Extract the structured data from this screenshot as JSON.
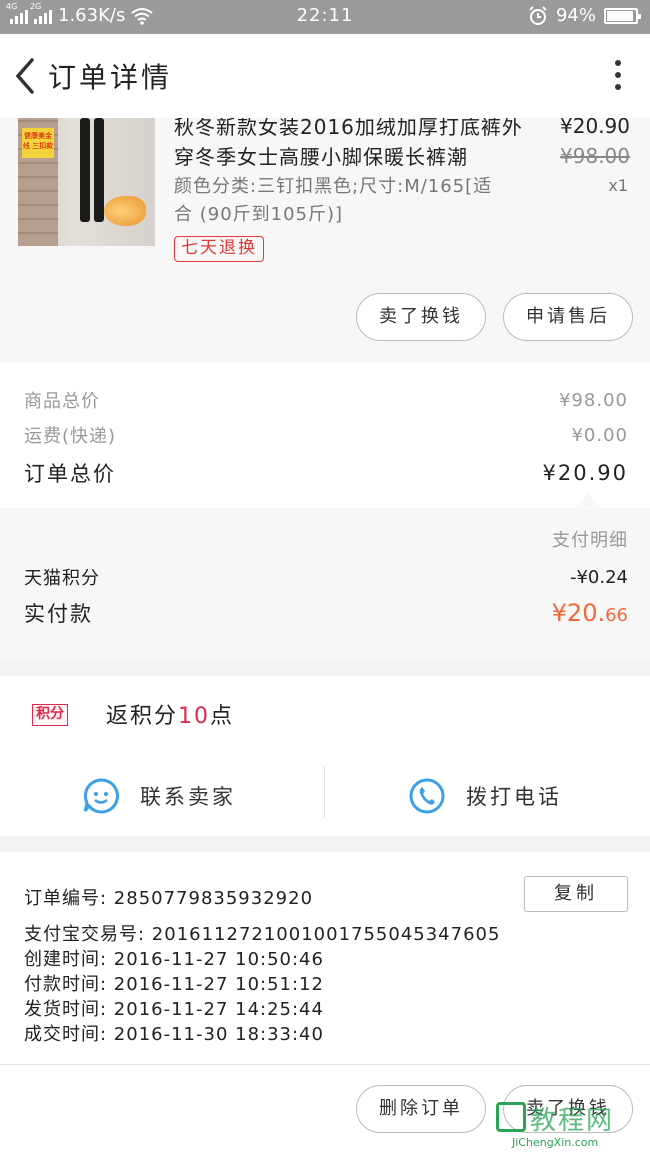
{
  "status_bar": {
    "network_left": "4G",
    "network_right": "2G",
    "speed": "1.63K/s",
    "time": "22:11",
    "battery": "94%",
    "battery_level": 0.94
  },
  "header": {
    "title": "订单详情"
  },
  "product": {
    "title": "秋冬新款女装2016加绒加厚打底裤外穿冬季女士高腰小脚保暖长裤潮",
    "spec": "颜色分类:三钉扣黑色;尺寸:M/165[适合 (90斤到105斤)]",
    "price": "¥20.90",
    "original_price": "¥98.00",
    "quantity": "x1",
    "badge": "七天退换",
    "thumb_tag": "健康美金线 三扣款",
    "buttons": {
      "sell_for_cash": "卖了换钱",
      "after_sale": "申请售后"
    }
  },
  "summary": {
    "goods_total_label": "商品总价",
    "goods_total": "¥98.00",
    "shipping_label": "运费(快递)",
    "shipping": "¥0.00",
    "order_total_label": "订单总价",
    "order_total": "¥20.90"
  },
  "payment": {
    "detail_label": "支付明细",
    "points_label": "天猫积分",
    "points_value": "-¥0.24",
    "paid_label": "实付款",
    "paid_main": "¥20.",
    "paid_cents": "66"
  },
  "points": {
    "badge": "积分",
    "text_prefix": "返积分",
    "amount": "10",
    "text_suffix": "点"
  },
  "contact": {
    "seller": "联系卖家",
    "call": "拨打电话"
  },
  "order_info": {
    "order_no": "订单编号:  2850779835932920",
    "copy_button": "复制",
    "alipay_no": "支付宝交易号:  2016112721001001755045347605",
    "created": "创建时间:  2016-11-27 10:50:46",
    "paid": "付款时间:  2016-11-27 10:51:12",
    "shipped": "发货时间:  2016-11-27 14:25:44",
    "completed": "成交时间:  2016-11-30 18:33:40"
  },
  "bottom_bar": {
    "delete_order": "删除订单",
    "sell_for_cash": "卖了换钱"
  },
  "watermark": {
    "cn": "教程网",
    "en": "JiChengXin.com"
  },
  "colors": {
    "accent_orange": "#f0693a",
    "badge_red": "#e03a3a",
    "icon_blue": "#3ea0e6"
  }
}
